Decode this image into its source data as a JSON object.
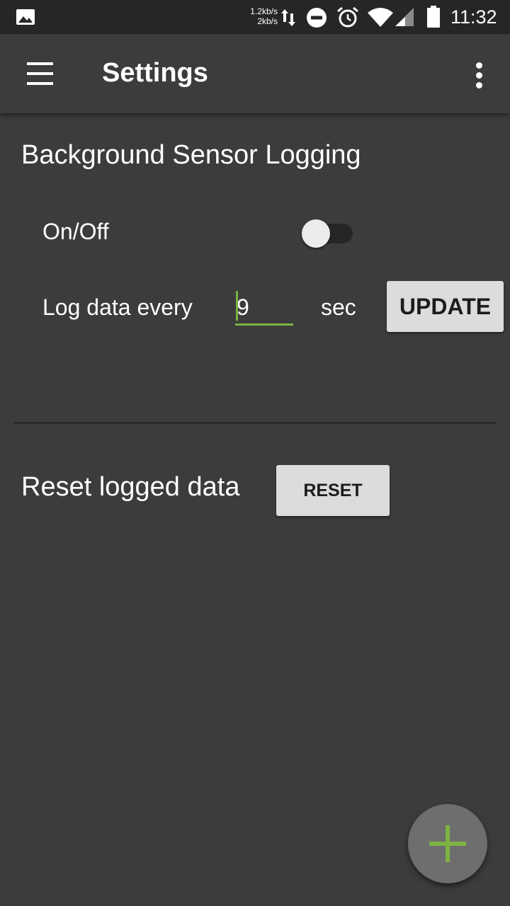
{
  "status_bar": {
    "net_up": "1.2kb/s",
    "net_down": "2kb/s",
    "time": "11:32",
    "icons": [
      "image-icon",
      "data-transfer-icon",
      "do-not-disturb-icon",
      "alarm-icon",
      "wifi-icon",
      "cell-signal-icon",
      "battery-icon"
    ]
  },
  "app_bar": {
    "title": "Settings",
    "menu_icon": "hamburger-menu-icon",
    "overflow_icon": "more-vert-icon"
  },
  "background_logging": {
    "section_title": "Background Sensor Logging",
    "onoff_label": "On/Off",
    "switch_on": false,
    "log_label": "Log data every",
    "interval_value": "9",
    "unit_label": "sec",
    "update_label": "UPDATE"
  },
  "reset": {
    "label": "Reset logged data",
    "button_label": "RESET"
  },
  "fab": {
    "icon": "plus-icon"
  },
  "colors": {
    "background": "#3c3c3c",
    "status_bar": "#262626",
    "accent": "#7cb342",
    "button_bg": "#dcdcdc",
    "fab_bg": "#6e6e6e"
  }
}
